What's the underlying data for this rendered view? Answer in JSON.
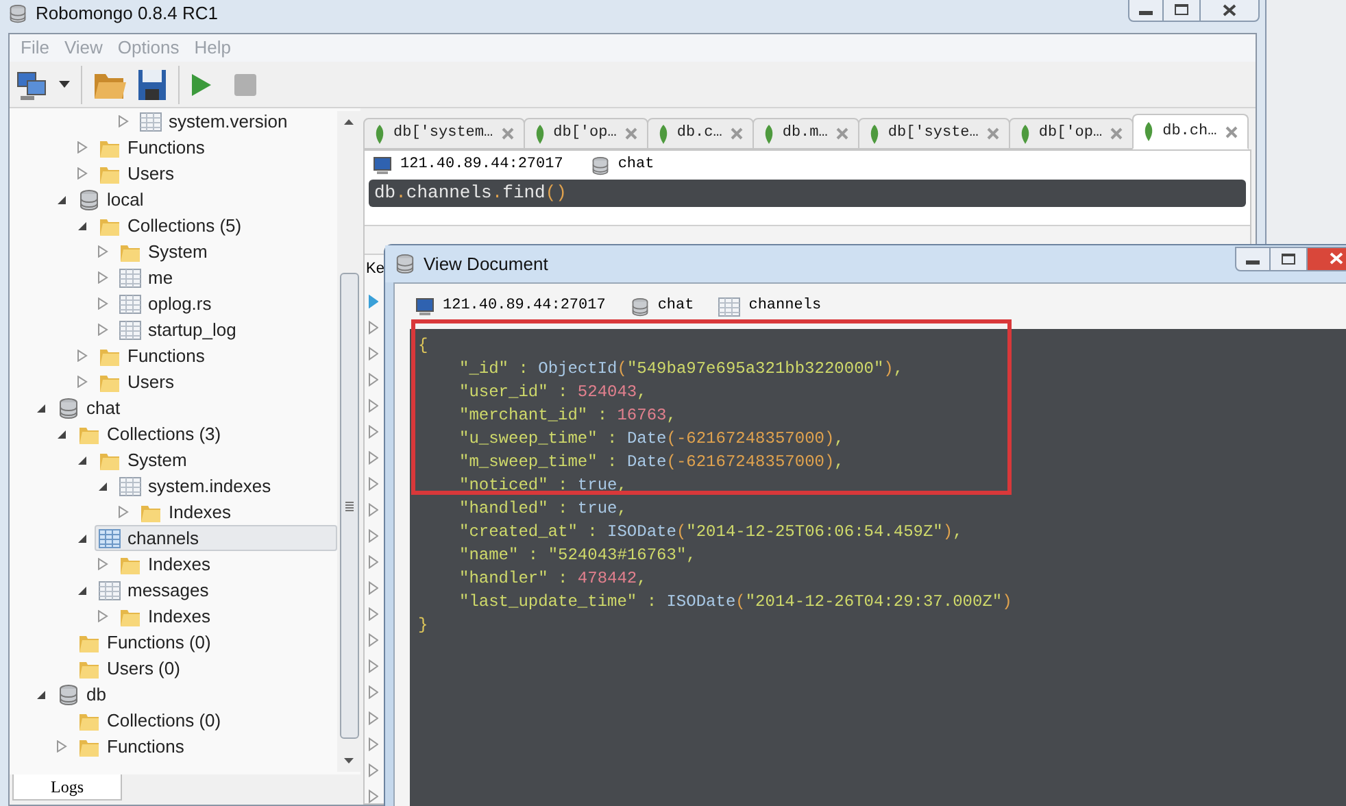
{
  "window": {
    "title": "Robomongo 0.8.4 RC1"
  },
  "menu": [
    "File",
    "View",
    "Options",
    "Help"
  ],
  "tree": [
    {
      "children": [
        {
          "children": [
            {
              "children": [
                {
                  "children": [
                    {
                      "label": "system.version",
                      "kind": "table",
                      "expanded": false,
                      "selected": false
                    }
                  ]
                }
              ]
            },
            {
              "label": "Functions",
              "kind": "folder",
              "expanded": false,
              "selected": false
            },
            {
              "label": "Users",
              "kind": "folder",
              "expanded": false,
              "selected": false
            }
          ]
        },
        {
          "label": "local",
          "kind": "database",
          "expanded": true,
          "selected": false,
          "children": [
            {
              "label": "Collections (5)",
              "kind": "folder",
              "expanded": true,
              "selected": false,
              "children": [
                {
                  "label": "System",
                  "kind": "folder",
                  "expanded": false,
                  "selected": false
                },
                {
                  "label": "me",
                  "kind": "table",
                  "expanded": false,
                  "selected": false
                },
                {
                  "label": "oplog.rs",
                  "kind": "table",
                  "expanded": false,
                  "selected": false
                },
                {
                  "label": "startup_log",
                  "kind": "table",
                  "expanded": false,
                  "selected": false
                }
              ]
            },
            {
              "label": "Functions",
              "kind": "folder",
              "expanded": false,
              "selected": false
            },
            {
              "label": "Users",
              "kind": "folder",
              "expanded": false,
              "selected": false
            }
          ]
        }
      ]
    },
    {
      "label": "chat",
      "kind": "database",
      "expanded": true,
      "selected": false,
      "children": [
        {
          "label": "Collections (3)",
          "kind": "folder",
          "expanded": true,
          "selected": false,
          "children": [
            {
              "label": "System",
              "kind": "folder",
              "expanded": true,
              "selected": false,
              "children": [
                {
                  "label": "system.indexes",
                  "kind": "table",
                  "expanded": true,
                  "selected": false,
                  "children": [
                    {
                      "label": "Indexes",
                      "kind": "folder",
                      "expanded": false,
                      "selected": false
                    }
                  ]
                }
              ]
            },
            {
              "label": "channels",
              "kind": "table",
              "expanded": true,
              "selected": true,
              "children": [
                {
                  "label": "Indexes",
                  "kind": "folder",
                  "expanded": false,
                  "selected": false
                }
              ]
            },
            {
              "label": "messages",
              "kind": "table",
              "expanded": true,
              "selected": false,
              "children": [
                {
                  "label": "Indexes",
                  "kind": "folder",
                  "expanded": false,
                  "selected": false
                }
              ]
            }
          ]
        },
        {
          "label": "Functions (0)",
          "kind": "folder",
          "selected": false
        },
        {
          "label": "Users (0)",
          "kind": "folder",
          "selected": false
        }
      ]
    },
    {
      "label": "db",
      "kind": "database",
      "expanded": true,
      "selected": false,
      "children": [
        {
          "label": "Collections (0)",
          "kind": "folder",
          "selected": false
        },
        {
          "label": "Functions",
          "kind": "folder",
          "expanded": false,
          "selected": false
        }
      ]
    }
  ],
  "bottom_tab": "Logs",
  "tabs": [
    {
      "label": "db['system…",
      "selected": false
    },
    {
      "label": "db['op…",
      "selected": false
    },
    {
      "label": "db.c…",
      "selected": false
    },
    {
      "label": "db.m…",
      "selected": false
    },
    {
      "label": "db['syste…",
      "selected": false
    },
    {
      "label": "db['op…",
      "selected": false
    },
    {
      "label": "db.ch…",
      "selected": true
    }
  ],
  "connection": {
    "server": "121.40.89.44:27017",
    "database": "chat"
  },
  "query": [
    {
      "kind": "text",
      "text": "db"
    },
    {
      "kind": "paren",
      "text": "."
    },
    {
      "kind": "text",
      "text": "channels"
    },
    {
      "kind": "paren",
      "text": "."
    },
    {
      "kind": "text",
      "text": "find"
    },
    {
      "kind": "paren",
      "text": "()"
    }
  ],
  "results": {
    "column_1": "Ke",
    "rows": [
      {
        "selected": true
      },
      {
        "selected": false
      },
      {
        "selected": false
      },
      {
        "selected": false
      },
      {
        "selected": false
      },
      {
        "selected": false
      },
      {
        "selected": false
      },
      {
        "selected": false
      },
      {
        "selected": false
      },
      {
        "selected": false
      },
      {
        "selected": false
      },
      {
        "selected": false
      },
      {
        "selected": false
      },
      {
        "selected": false
      },
      {
        "selected": false
      },
      {
        "selected": false
      },
      {
        "selected": false
      },
      {
        "selected": false
      },
      {
        "selected": false
      },
      {
        "selected": false
      }
    ]
  },
  "dialog": {
    "title": "View Document",
    "server": "121.40.89.44:27017",
    "database": "chat",
    "collection": "channels",
    "lines": [
      {
        "kind": "brace",
        "tokens": [
          {
            "kind": "brace",
            "text": "{"
          }
        ]
      },
      {
        "kind": "field",
        "tokens": [
          {
            "kind": "key",
            "text": "\"_id\""
          },
          {
            "kind": "key",
            "text": " : "
          },
          {
            "kind": "func",
            "text": "ObjectId"
          },
          {
            "kind": "paren",
            "text": "("
          },
          {
            "kind": "key",
            "text": "\"549ba97e695a321bb3220000\""
          },
          {
            "kind": "paren",
            "text": ")"
          },
          {
            "kind": "key",
            "text": ","
          }
        ]
      },
      {
        "kind": "field",
        "tokens": [
          {
            "kind": "key",
            "text": "\"user_id\""
          },
          {
            "kind": "key",
            "text": " : "
          },
          {
            "kind": "num",
            "text": "524043"
          },
          {
            "kind": "key",
            "text": ","
          }
        ]
      },
      {
        "kind": "field",
        "tokens": [
          {
            "kind": "key",
            "text": "\"merchant_id\""
          },
          {
            "kind": "key",
            "text": " : "
          },
          {
            "kind": "num",
            "text": "16763"
          },
          {
            "kind": "key",
            "text": ","
          }
        ]
      },
      {
        "kind": "field",
        "tokens": [
          {
            "kind": "key",
            "text": "\"u_sweep_time\""
          },
          {
            "kind": "key",
            "text": " : "
          },
          {
            "kind": "func",
            "text": "Date"
          },
          {
            "kind": "paren",
            "text": "(-62167248357000)"
          },
          {
            "kind": "key",
            "text": ","
          }
        ]
      },
      {
        "kind": "field",
        "tokens": [
          {
            "kind": "key",
            "text": "\"m_sweep_time\""
          },
          {
            "kind": "key",
            "text": " : "
          },
          {
            "kind": "func",
            "text": "Date"
          },
          {
            "kind": "paren",
            "text": "(-62167248357000)"
          },
          {
            "kind": "key",
            "text": ","
          }
        ]
      },
      {
        "kind": "field",
        "tokens": [
          {
            "kind": "key",
            "text": "\"noticed\""
          },
          {
            "kind": "key",
            "text": " : "
          },
          {
            "kind": "func",
            "text": "true"
          },
          {
            "kind": "key",
            "text": ","
          }
        ]
      },
      {
        "kind": "field",
        "tokens": [
          {
            "kind": "key",
            "text": "\"handled\""
          },
          {
            "kind": "key",
            "text": " : "
          },
          {
            "kind": "func",
            "text": "true"
          },
          {
            "kind": "key",
            "text": ","
          }
        ]
      },
      {
        "kind": "field",
        "tokens": [
          {
            "kind": "key",
            "text": "\"created_at\""
          },
          {
            "kind": "key",
            "text": " : "
          },
          {
            "kind": "func",
            "text": "ISODate"
          },
          {
            "kind": "paren",
            "text": "("
          },
          {
            "kind": "key",
            "text": "\"2014-12-25T06:06:54.459Z\""
          },
          {
            "kind": "paren",
            "text": ")"
          },
          {
            "kind": "key",
            "text": ","
          }
        ]
      },
      {
        "kind": "field",
        "tokens": [
          {
            "kind": "key",
            "text": "\"name\""
          },
          {
            "kind": "key",
            "text": " : "
          },
          {
            "kind": "key",
            "text": "\"524043#16763\""
          },
          {
            "kind": "key",
            "text": ","
          }
        ]
      },
      {
        "kind": "field",
        "tokens": [
          {
            "kind": "key",
            "text": "\"handler\""
          },
          {
            "kind": "key",
            "text": " : "
          },
          {
            "kind": "num",
            "text": "478442"
          },
          {
            "kind": "key",
            "text": ","
          }
        ]
      },
      {
        "kind": "field",
        "tokens": [
          {
            "kind": "key",
            "text": "\"last_update_time\""
          },
          {
            "kind": "key",
            "text": " : "
          },
          {
            "kind": "func",
            "text": "ISODate"
          },
          {
            "kind": "paren",
            "text": "("
          },
          {
            "kind": "key",
            "text": "\"2014-12-26T04:29:37.000Z\""
          },
          {
            "kind": "paren",
            "text": ")"
          }
        ]
      },
      {
        "kind": "brace",
        "tokens": [
          {
            "kind": "brace",
            "text": "}"
          }
        ]
      }
    ]
  }
}
